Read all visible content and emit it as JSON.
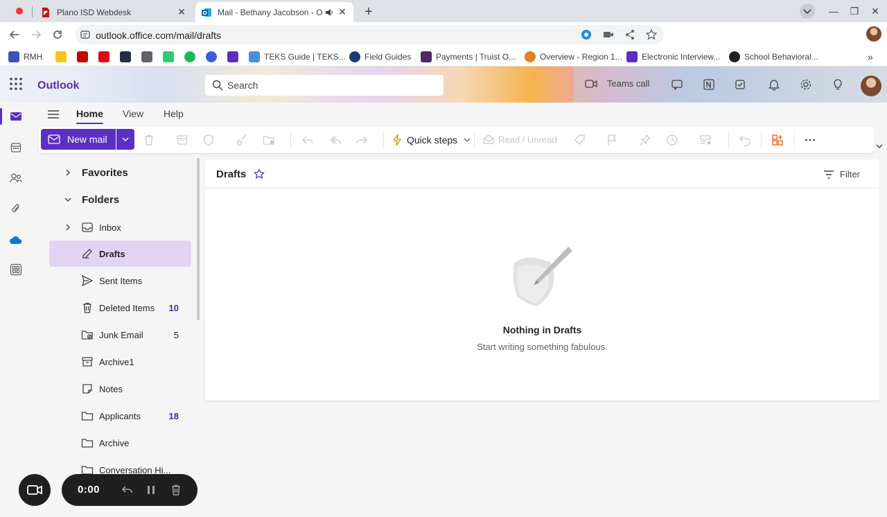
{
  "browser": {
    "tabs": [
      {
        "title": "Plano ISD Webdesk",
        "active": false
      },
      {
        "title": "Mail - Bethany Jacobson - O",
        "active": true
      }
    ],
    "url": "outlook.office.com/mail/drafts",
    "bookmarks": [
      {
        "label": "RMH",
        "color": "#3f51b5"
      },
      {
        "label": "",
        "color": "#f5c518"
      },
      {
        "label": "",
        "color": "#cc0000"
      },
      {
        "label": "",
        "color": "#e50914"
      },
      {
        "label": "",
        "color": "#232f3e"
      },
      {
        "label": "",
        "color": "#5f6368"
      },
      {
        "label": "",
        "color": "#2ecc71"
      },
      {
        "label": "",
        "color": "#1db954"
      },
      {
        "label": "",
        "color": "#3b5bdb"
      },
      {
        "label": "",
        "color": "#5b2fc4"
      },
      {
        "label": "TEKS Guide | TEKS...",
        "color": "#4a90d9"
      },
      {
        "label": "Field Guides",
        "color": "#1a3a7a"
      },
      {
        "label": "Payments | Truist O...",
        "color": "#4a2a6a"
      },
      {
        "label": "Overview - Region 1...",
        "color": "#e67e22"
      },
      {
        "label": "Electronic Interview...",
        "color": "#5b2fc4"
      },
      {
        "label": "School Behavioral...",
        "color": "#222222"
      }
    ]
  },
  "outlook": {
    "brand": "Outlook",
    "search_placeholder": "Search",
    "teams_call": "Teams call",
    "accent": "#5b2fc4"
  },
  "ribbon": {
    "tabs": [
      "Home",
      "View",
      "Help"
    ],
    "new_mail": "New mail",
    "quick_steps": "Quick steps",
    "read_unread": "Read / Unread"
  },
  "folders": {
    "favorites": "Favorites",
    "folders": "Folders",
    "items": [
      {
        "label": "Inbox",
        "count": "",
        "icon": "inbox-icon"
      },
      {
        "label": "Drafts",
        "count": "",
        "icon": "drafts-icon"
      },
      {
        "label": "Sent Items",
        "count": "",
        "icon": "send-icon"
      },
      {
        "label": "Deleted Items",
        "count": "10",
        "icon": "trash-icon"
      },
      {
        "label": "Junk Email",
        "count": "5",
        "icon": "junk-icon"
      },
      {
        "label": "Archive1",
        "count": "",
        "icon": "archive-icon"
      },
      {
        "label": "Notes",
        "count": "",
        "icon": "note-icon"
      },
      {
        "label": "Applicants",
        "count": "18",
        "icon": "folder-icon"
      },
      {
        "label": "Archive",
        "count": "",
        "icon": "folder-icon"
      },
      {
        "label": "Conversation Hi...",
        "count": "",
        "icon": "folder-icon"
      }
    ]
  },
  "pane": {
    "title": "Drafts",
    "filter": "Filter",
    "empty_title": "Nothing in Drafts",
    "empty_sub": "Start writing something fabulous."
  },
  "recorder": {
    "time": "0:00"
  }
}
